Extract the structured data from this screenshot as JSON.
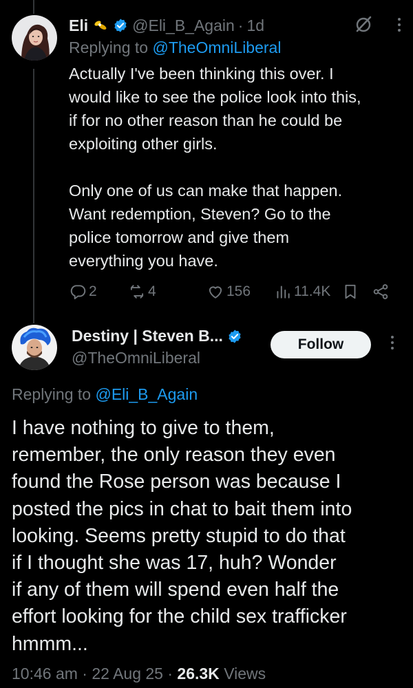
{
  "tweet1": {
    "name": "Eli",
    "handle": "@Eli_B_Again",
    "separator": "·",
    "time": "1d",
    "replying_prefix": "Replying to ",
    "replying_to": "@TheOmniLiberal",
    "body_p1": "Actually I've been thinking this over. I\nwould like to see the police look into this,\nif for no other reason than he could be\nexploiting other girls.",
    "body_p2": "Only one of us can make that happen.\nWant redemption, Steven? Go to the\npolice tomorrow and give them\neverything you have.",
    "stats": {
      "replies": "2",
      "reposts": "4",
      "likes": "156",
      "views": "11.4K"
    },
    "icons": [
      "badge-icon",
      "verified-icon",
      "grok-icon",
      "more-icon",
      "reply-icon",
      "repost-icon",
      "like-icon",
      "views-icon",
      "bookmark-icon",
      "share-icon"
    ]
  },
  "tweet2": {
    "name": "Destiny | Steven B...",
    "handle": "@TheOmniLiberal",
    "follow_label": "Follow",
    "replying_prefix": "Replying to ",
    "replying_to": "@Eli_B_Again",
    "body": "I have nothing to give to them,\nremember, the only reason they even\nfound the Rose person was because I\nposted the pics in chat to bait them into\nlooking. Seems pretty stupid to do that\nif I thought she was 17, huh? Wonder\nif any of them will spend even half the\neffort looking for the child sex trafficker\nhmmm...",
    "time": "10:46 am",
    "date": "22 Aug 25",
    "separator": "·",
    "views_count": "26.3K",
    "views_label": "Views"
  },
  "colors": {
    "background": "#000000",
    "text": "#e7e9ea",
    "muted": "#71767b",
    "link": "#1d9bf0",
    "verified": "#1d9bf0",
    "follow_bg": "#eff3f4",
    "follow_text": "#0f1419"
  }
}
